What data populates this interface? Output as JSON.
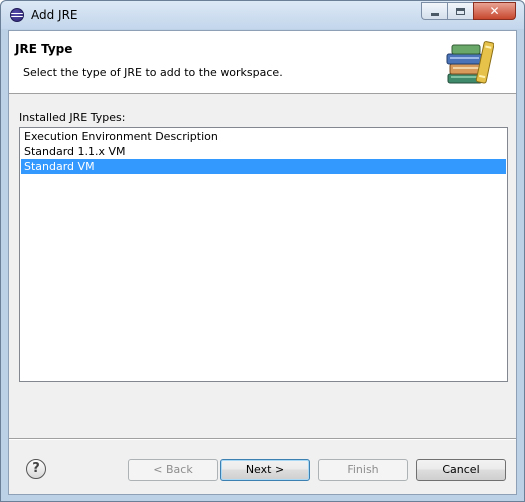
{
  "window": {
    "title": "Add JRE"
  },
  "header": {
    "title": "JRE Type",
    "description": "Select the type of JRE to add to the workspace."
  },
  "list": {
    "label": "Installed JRE Types:",
    "items": [
      {
        "label": "Execution Environment Description",
        "selected": false
      },
      {
        "label": "Standard 1.1.x VM",
        "selected": false
      },
      {
        "label": "Standard VM",
        "selected": true
      }
    ]
  },
  "buttons": {
    "help_glyph": "?",
    "back": "< Back",
    "next": "Next >",
    "finish": "Finish",
    "cancel": "Cancel"
  },
  "colors": {
    "selection": "#3399ff",
    "close_button": "#c7472e"
  }
}
